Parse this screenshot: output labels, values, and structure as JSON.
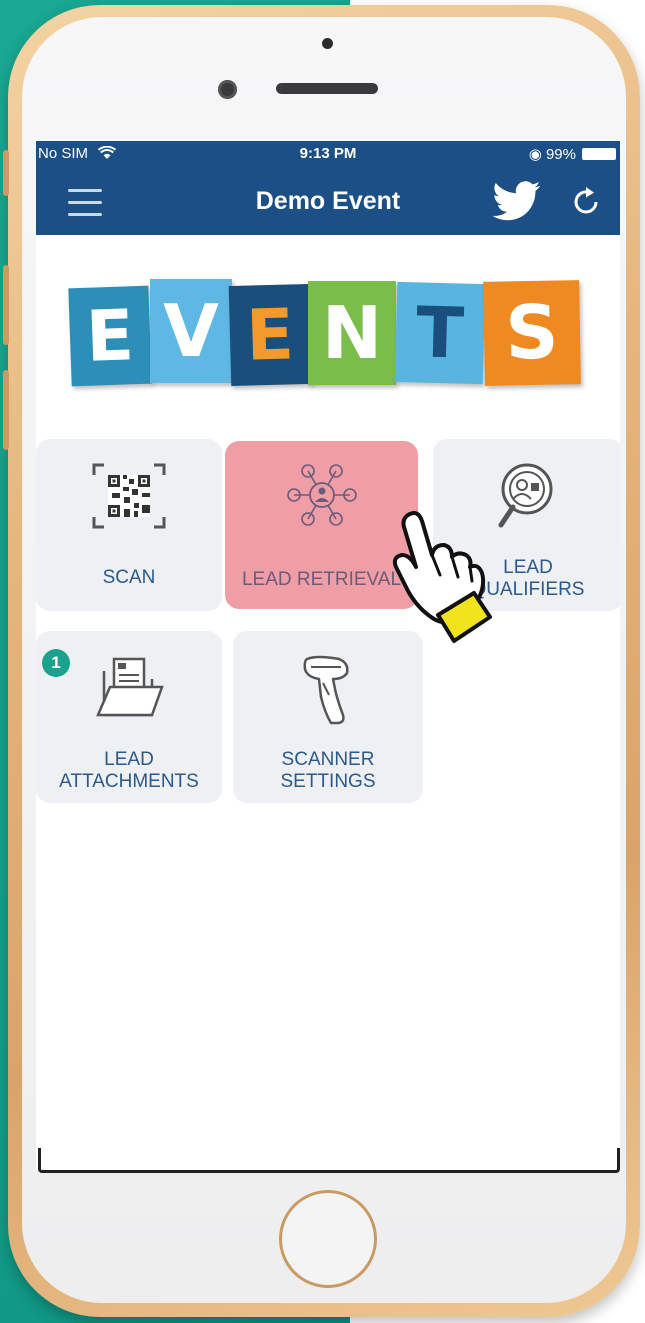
{
  "status_bar": {
    "carrier": "No SIM",
    "time": "9:13 PM",
    "battery": "99%"
  },
  "nav": {
    "title": "Demo Event",
    "icons": [
      "menu-icon",
      "twitter-icon",
      "refresh-icon"
    ]
  },
  "logo": {
    "letters": [
      "E",
      "V",
      "E",
      "N",
      "T",
      "S"
    ],
    "colors": [
      "#2d8fb8",
      "#5fb7e3",
      "#1a4e7c",
      "#7bbd4a",
      "#5ab4e0",
      "#ef8a22"
    ],
    "letter_colors": [
      "#ffffff",
      "#ffffff",
      "#f39a2b",
      "#ffffff",
      "#1a4e7c",
      "#ffffff"
    ]
  },
  "tiles": [
    {
      "label": "SCAN",
      "icon": "qr-code-icon",
      "active": false
    },
    {
      "label": "LEAD RETRIEVAL",
      "icon": "lead-network-icon",
      "active": true
    },
    {
      "label_line1": "LEAD",
      "label_line2": "QUALIFIERS",
      "icon": "magnifier-person-icon",
      "active": false
    },
    {
      "label_line1": "LEAD",
      "label_line2": "ATTACHMENTS",
      "icon": "folder-document-icon",
      "badge": "1",
      "active": false
    },
    {
      "label_line1": "SCANNER",
      "label_line2": "SETTINGS",
      "icon": "barcode-scanner-icon",
      "active": false
    }
  ],
  "colors": {
    "nav_bg": "#1c4f86",
    "tile_bg": "#eef0f4",
    "tile_active_bg": "#ef9ea6",
    "accent_teal": "#1aa28c"
  }
}
